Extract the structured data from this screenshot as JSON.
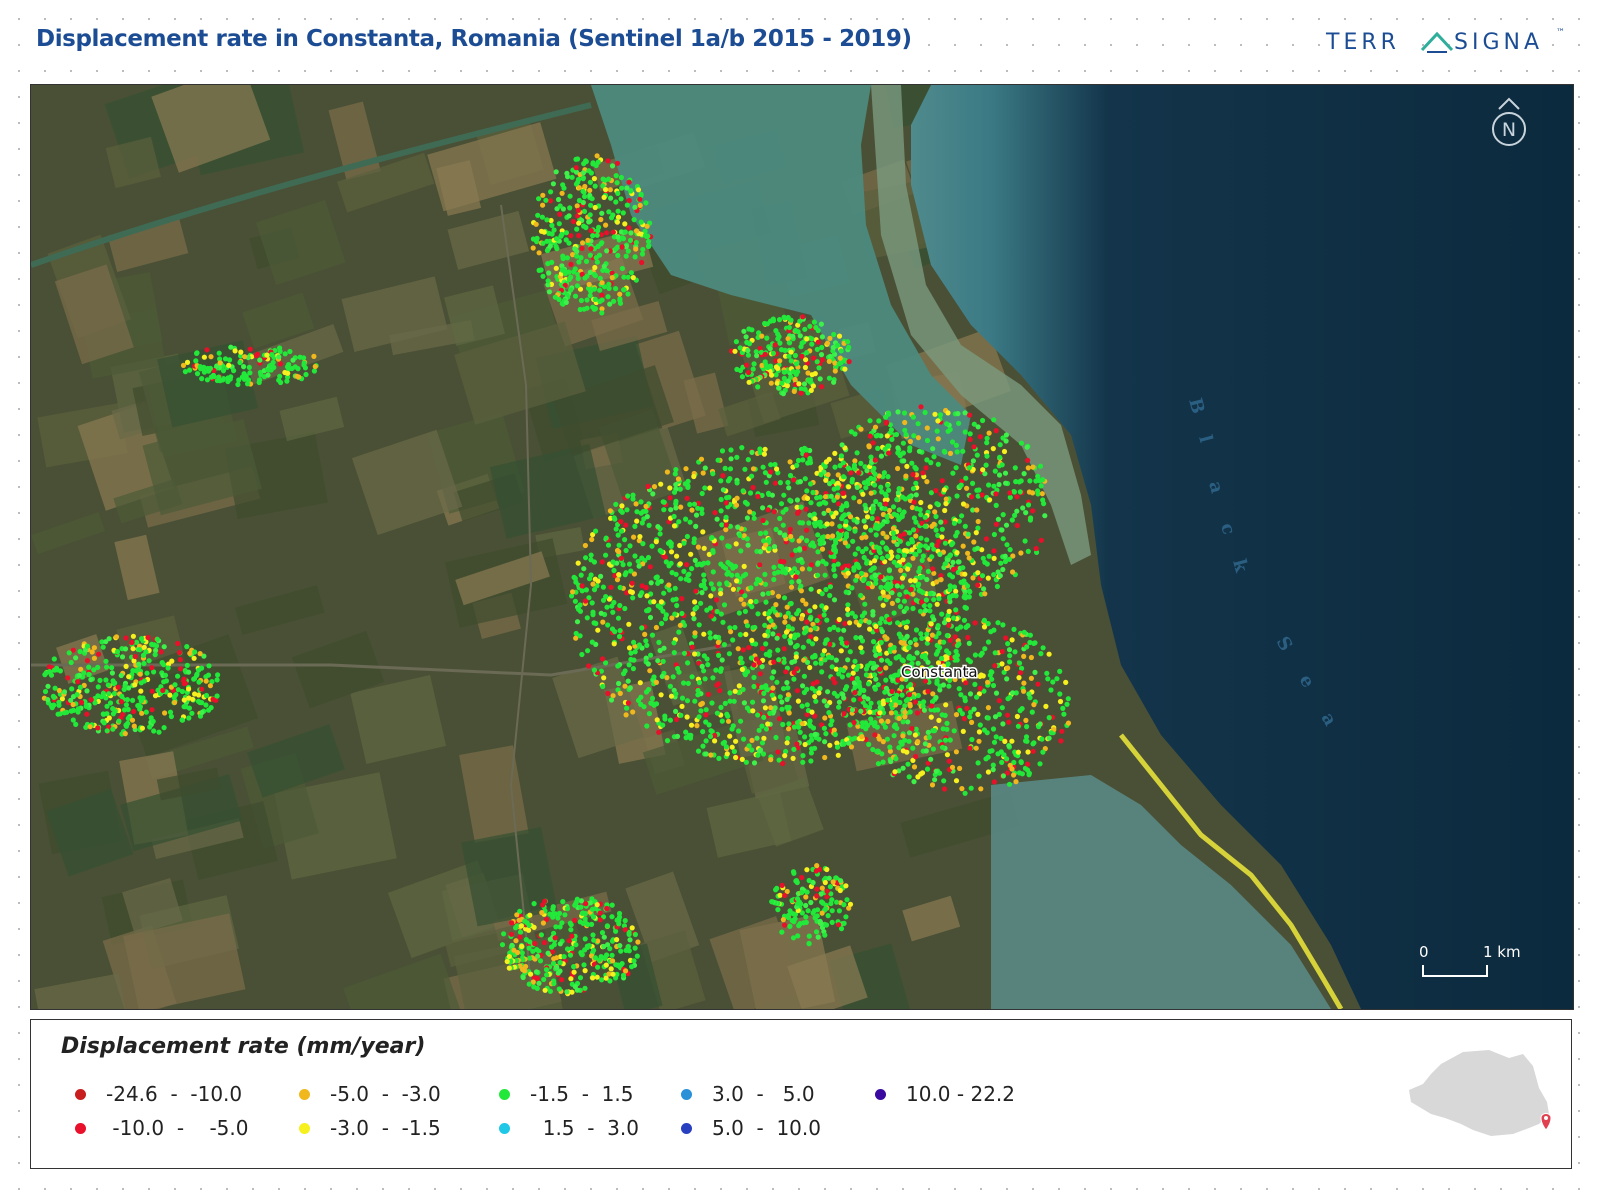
{
  "title": "Displacement rate in Constanta, Romania (Sentinel 1a/b 2015 - 2019)",
  "logo": {
    "part1": "TERR",
    "part2": "SIGNA",
    "trademark": "™"
  },
  "map": {
    "city_label": "Constanta",
    "sea_label_letters": [
      "B",
      "l",
      "a",
      "c",
      "k",
      "S",
      "e",
      "a"
    ],
    "north_arrow_letter": "N",
    "scale_bar": {
      "start": "0",
      "end": "1 km"
    }
  },
  "legend": {
    "title": "Displacement rate (mm/year)",
    "items": [
      {
        "label": "-24.6  -  -10.0",
        "color": "#c81e1e"
      },
      {
        "label": " -10.0  -    -5.0",
        "color": "#e8102a"
      },
      {
        "label": "-5.0  -  -3.0",
        "color": "#f0b81c"
      },
      {
        "label": "-3.0  -  -1.5",
        "color": "#f5f01e"
      },
      {
        "label": "-1.5  -  1.5",
        "color": "#22e83a"
      },
      {
        "label": "  1.5  -  3.0",
        "color": "#1ec8e6"
      },
      {
        "label": "3.0  -   5.0",
        "color": "#2a90d8"
      },
      {
        "label": "5.0  -  10.0",
        "color": "#2840c0"
      },
      {
        "label": "10.0 - 22.2",
        "color": "#3a0aa0"
      }
    ]
  }
}
